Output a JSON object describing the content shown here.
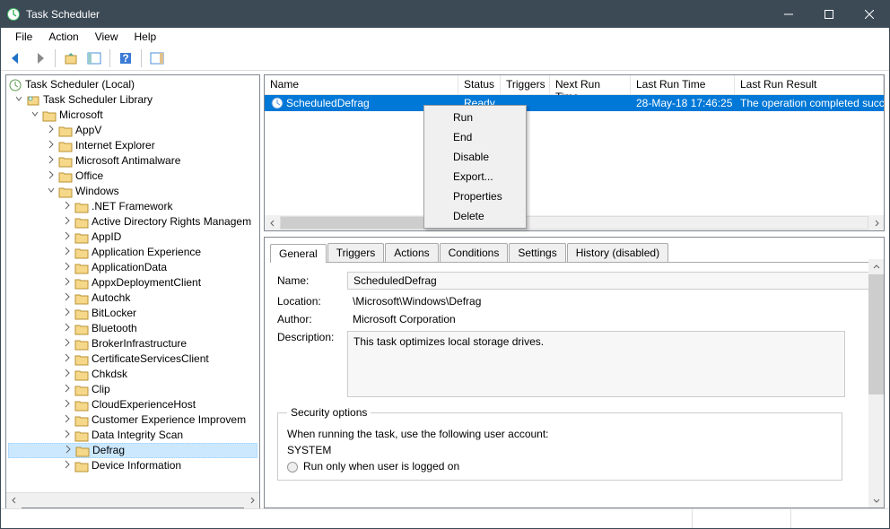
{
  "window": {
    "title": "Task Scheduler"
  },
  "menus": {
    "file": "File",
    "action": "Action",
    "view": "View",
    "help": "Help"
  },
  "tree": {
    "root": "Task Scheduler (Local)",
    "library": "Task Scheduler Library",
    "microsoft": "Microsoft",
    "items": [
      "AppV",
      "Internet Explorer",
      "Microsoft Antimalware",
      "Office",
      "Windows",
      ".NET Framework",
      "Active Directory Rights Managem",
      "AppID",
      "Application Experience",
      "ApplicationData",
      "AppxDeploymentClient",
      "Autochk",
      "BitLocker",
      "Bluetooth",
      "BrokerInfrastructure",
      "CertificateServicesClient",
      "Chkdsk",
      "Clip",
      "CloudExperienceHost",
      "Customer Experience Improvem",
      "Data Integrity Scan",
      "Defrag",
      "Device Information"
    ]
  },
  "list": {
    "cols": {
      "name": "Name",
      "status": "Status",
      "triggers": "Triggers",
      "next": "Next Run Time",
      "last": "Last Run Time",
      "result": "Last Run Result"
    },
    "row": {
      "name": "ScheduledDefrag",
      "status": "Ready",
      "next": "",
      "last": "28-May-18 17:46:25",
      "result": "The operation completed succ"
    }
  },
  "tabs": {
    "general": "General",
    "triggers": "Triggers",
    "actions": "Actions",
    "conditions": "Conditions",
    "settings": "Settings",
    "history": "History (disabled)"
  },
  "details": {
    "labels": {
      "name": "Name:",
      "location": "Location:",
      "author": "Author:",
      "description": "Description:"
    },
    "name": "ScheduledDefrag",
    "location": "\\Microsoft\\Windows\\Defrag",
    "author": "Microsoft Corporation",
    "description": "This task optimizes local storage drives."
  },
  "security": {
    "legend": "Security options",
    "line1": "When running the task, use the following user account:",
    "account": "SYSTEM",
    "radio1": "Run only when user is logged on"
  },
  "context": {
    "run": "Run",
    "end": "End",
    "disable": "Disable",
    "export": "Export...",
    "properties": "Properties",
    "delete": "Delete"
  }
}
